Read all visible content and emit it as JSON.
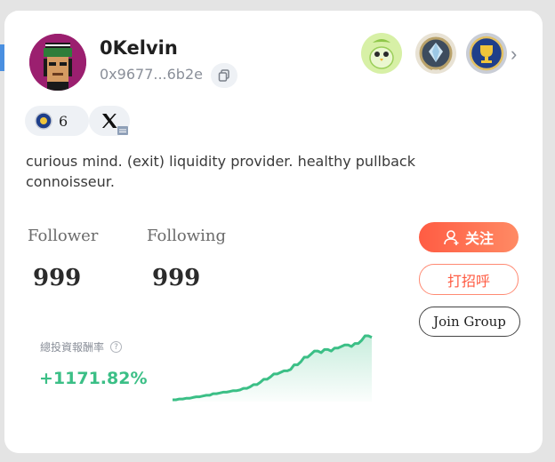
{
  "profile": {
    "username": "0Kelvin",
    "address": "0x9677...6b2e",
    "bio": "curious mind. (exit) liquidity provider. healthy pullback connoisseur."
  },
  "badges": [
    "green-bird-badge",
    "diamond-wreath-badge",
    "trophy-badge"
  ],
  "social": {
    "medal_count": "6",
    "twitter_icon": "x-icon"
  },
  "stats": {
    "follower_label": "Follower",
    "follower_value": "999",
    "following_label": "Following",
    "following_value": "999"
  },
  "actions": {
    "follow_label": "关注",
    "greet_label": "打招呼",
    "join_label": "Join Group"
  },
  "performance": {
    "label": "總投資報酬率",
    "value": "+1171.82%"
  },
  "chart_data": {
    "type": "line",
    "x": [
      0,
      1,
      2,
      3,
      4,
      5,
      6,
      7,
      8,
      9,
      10,
      11,
      12,
      13,
      14,
      15,
      16,
      17,
      18,
      19,
      20,
      21,
      22,
      23,
      24,
      25,
      26,
      27,
      28,
      29,
      30,
      31,
      32,
      33,
      34,
      35,
      36,
      37,
      38,
      39,
      40,
      41,
      42,
      43,
      44,
      45,
      46,
      47,
      48,
      49,
      50,
      51,
      52,
      53,
      54,
      55,
      56,
      57,
      58,
      59
    ],
    "values": [
      0,
      0,
      1,
      1,
      2,
      2,
      3,
      4,
      4,
      5,
      6,
      6,
      8,
      8,
      9,
      10,
      10,
      11,
      12,
      12,
      13,
      15,
      15,
      17,
      20,
      20,
      23,
      27,
      27,
      30,
      34,
      34,
      36,
      38,
      38,
      40,
      46,
      46,
      50,
      56,
      56,
      60,
      64,
      64,
      62,
      66,
      66,
      64,
      68,
      68,
      70,
      72,
      72,
      70,
      74,
      74,
      78,
      84,
      84,
      82
    ],
    "colors": {
      "line": "#3bbf86",
      "fill": "#3bbf86"
    }
  },
  "colors": {
    "accent": "#ff5c43",
    "positive": "#3bbf86"
  }
}
